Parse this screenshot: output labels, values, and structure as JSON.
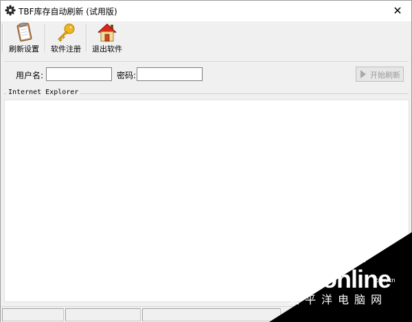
{
  "window": {
    "title": "TBF库存自动刷新 (试用版)",
    "close_glyph": "✕",
    "app_icon": "flower-icon"
  },
  "toolbar": {
    "items": [
      {
        "label": "刷新设置",
        "icon": "clipboard-icon"
      },
      {
        "label": "软件注册",
        "icon": "key-icon"
      },
      {
        "label": "退出软件",
        "icon": "home-icon"
      }
    ]
  },
  "login": {
    "username_label": "用户名:",
    "username_value": "",
    "password_label": "密码:",
    "password_value": "",
    "start_button_label": "开始刷新",
    "start_button_enabled": false
  },
  "browser": {
    "group_label": "Internet Explorer"
  },
  "statusbar": {
    "panels": [
      "",
      "",
      ""
    ]
  },
  "watermark": {
    "brand": "PConline",
    "domain": ".com.cn",
    "chinese": "太平洋电脑网",
    "color": "#000000"
  }
}
